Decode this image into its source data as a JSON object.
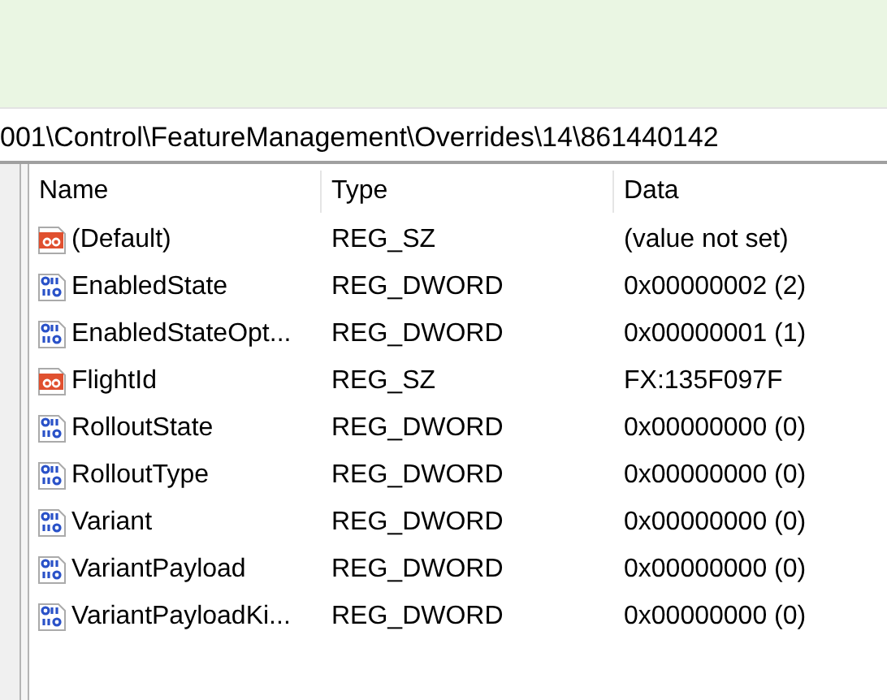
{
  "address_bar": {
    "path": "001\\Control\\FeatureManagement\\Overrides\\14\\861440142"
  },
  "table": {
    "columns": [
      "Name",
      "Type",
      "Data"
    ],
    "rows": [
      {
        "kind": "string",
        "name": "(Default)",
        "type": "REG_SZ",
        "data": "(value not set)"
      },
      {
        "kind": "binary",
        "name": "EnabledState",
        "type": "REG_DWORD",
        "data": "0x00000002 (2)"
      },
      {
        "kind": "binary",
        "name": "EnabledStateOpt...",
        "type": "REG_DWORD",
        "data": "0x00000001 (1)"
      },
      {
        "kind": "string",
        "name": "FlightId",
        "type": "REG_SZ",
        "data": "FX:135F097F"
      },
      {
        "kind": "binary",
        "name": "RolloutState",
        "type": "REG_DWORD",
        "data": "0x00000000 (0)"
      },
      {
        "kind": "binary",
        "name": "RolloutType",
        "type": "REG_DWORD",
        "data": "0x00000000 (0)"
      },
      {
        "kind": "binary",
        "name": "Variant",
        "type": "REG_DWORD",
        "data": "0x00000000 (0)"
      },
      {
        "kind": "binary",
        "name": "VariantPayload",
        "type": "REG_DWORD",
        "data": "0x00000000 (0)"
      },
      {
        "kind": "binary",
        "name": "VariantPayloadKi...",
        "type": "REG_DWORD",
        "data": "0x00000000 (0)"
      }
    ]
  }
}
